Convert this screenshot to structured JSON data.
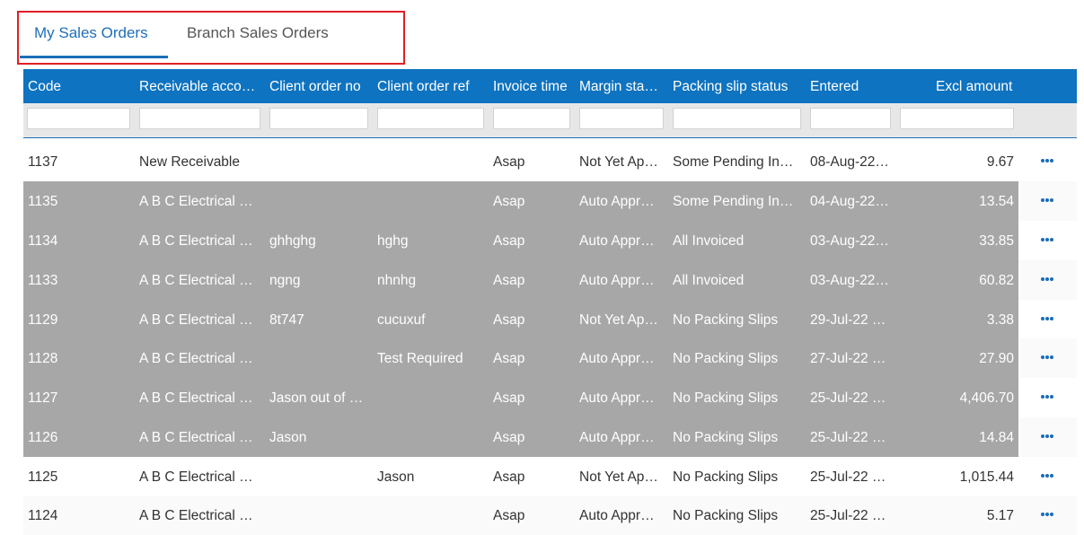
{
  "tabs": [
    {
      "label": "My Sales Orders",
      "active": true
    },
    {
      "label": "Branch Sales Orders",
      "active": false
    }
  ],
  "columns": [
    "Code",
    "Receivable acco…",
    "Client order no",
    "Client order ref",
    "Invoice time",
    "Margin sta…",
    "Packing slip status",
    "Entered",
    "Excl amount"
  ],
  "rows": [
    {
      "code": "1137",
      "receivable": "New Receivable",
      "client_no": "",
      "client_ref": "",
      "invoice_time": "Asap",
      "margin": "Not Yet Ap…",
      "packing": "Some Pending In…",
      "entered": "08-Aug-22…",
      "amount": "9.67",
      "selected": false
    },
    {
      "code": "1135",
      "receivable": "A B C Electrical …",
      "client_no": "",
      "client_ref": "",
      "invoice_time": "Asap",
      "margin": "Auto Appr…",
      "packing": "Some Pending In…",
      "entered": "04-Aug-22…",
      "amount": "13.54",
      "selected": true
    },
    {
      "code": "1134",
      "receivable": "A B C Electrical …",
      "client_no": "ghhghg",
      "client_ref": "hghg",
      "invoice_time": "Asap",
      "margin": "Auto Appr…",
      "packing": "All Invoiced",
      "entered": "03-Aug-22…",
      "amount": "33.85",
      "selected": true
    },
    {
      "code": "1133",
      "receivable": "A B C Electrical …",
      "client_no": "ngng",
      "client_ref": "nhnhg",
      "invoice_time": "Asap",
      "margin": "Auto Appr…",
      "packing": "All Invoiced",
      "entered": "03-Aug-22…",
      "amount": "60.82",
      "selected": true
    },
    {
      "code": "1129",
      "receivable": "A B C Electrical …",
      "client_no": "8t747",
      "client_ref": "cucuxuf",
      "invoice_time": "Asap",
      "margin": "Not Yet Ap…",
      "packing": "No Packing Slips",
      "entered": "29-Jul-22 …",
      "amount": "3.38",
      "selected": true
    },
    {
      "code": "1128",
      "receivable": "A B C Electrical …",
      "client_no": "",
      "client_ref": "Test Required",
      "invoice_time": "Asap",
      "margin": "Auto Appr…",
      "packing": "No Packing Slips",
      "entered": "27-Jul-22 …",
      "amount": "27.90",
      "selected": true
    },
    {
      "code": "1127",
      "receivable": "A B C Electrical …",
      "client_no": "Jason out of …",
      "client_ref": "",
      "invoice_time": "Asap",
      "margin": "Auto Appr…",
      "packing": "No Packing Slips",
      "entered": "25-Jul-22 …",
      "amount": "4,406.70",
      "selected": true
    },
    {
      "code": "1126",
      "receivable": "A B C Electrical …",
      "client_no": "Jason",
      "client_ref": "",
      "invoice_time": "Asap",
      "margin": "Auto Appr…",
      "packing": "No Packing Slips",
      "entered": "25-Jul-22 …",
      "amount": "14.84",
      "selected": true
    },
    {
      "code": "1125",
      "receivable": "A B C Electrical …",
      "client_no": "",
      "client_ref": "Jason",
      "invoice_time": "Asap",
      "margin": "Not Yet Ap…",
      "packing": "No Packing Slips",
      "entered": "25-Jul-22 …",
      "amount": "1,015.44",
      "selected": false
    },
    {
      "code": "1124",
      "receivable": "A B C Electrical …",
      "client_no": "",
      "client_ref": "",
      "invoice_time": "Asap",
      "margin": "Auto Appr…",
      "packing": "No Packing Slips",
      "entered": "25-Jul-22 …",
      "amount": "5.17",
      "selected": false
    }
  ],
  "colors": {
    "header": "#0e73c0",
    "selected_row": "#a7a7a7",
    "tab_active": "#1f6eb8",
    "highlight_border": "#e21f26"
  },
  "icons": {
    "row_menu": "more-horizontal-icon"
  }
}
